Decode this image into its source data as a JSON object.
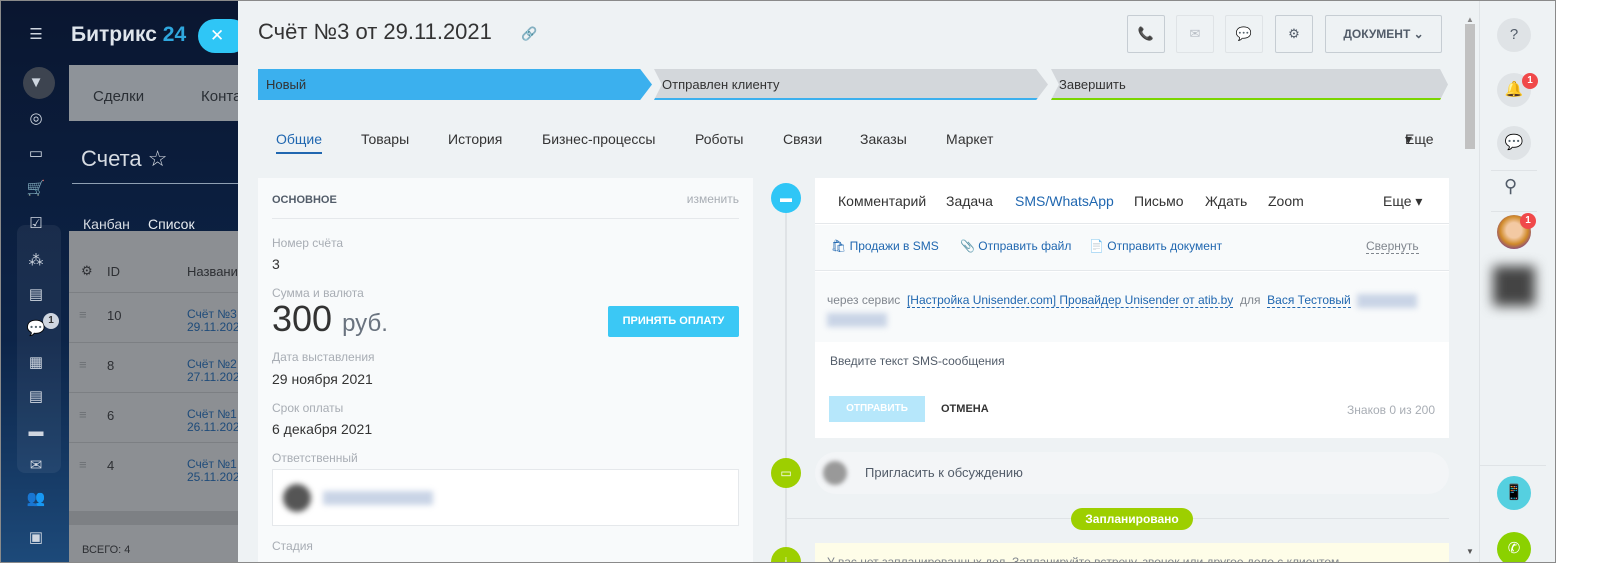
{
  "background": {
    "logo": "Битрикс",
    "logo_accent": "24",
    "crm_tabs": [
      "Сделки",
      "Конта"
    ],
    "page_title": "Счета",
    "views": [
      "Канбан",
      "Список"
    ],
    "grid_headers": [
      "ID",
      "Названи"
    ],
    "rows": [
      {
        "id": "10",
        "name": "Счёт №3",
        "date": "29.11.202"
      },
      {
        "id": "8",
        "name": "Счёт №2",
        "date": "27.11.202"
      },
      {
        "id": "6",
        "name": "Счёт №1",
        "date": "26.11.202"
      },
      {
        "id": "4",
        "name": "Счёт №1",
        "date": "25.11.202"
      }
    ],
    "total": "ВСЕГО: 4",
    "chat_badge": "1"
  },
  "header": {
    "title": "Счёт №3 от 29.11.2021",
    "document_button": "ДОКУМЕНТ"
  },
  "stages": [
    {
      "label": "Новый",
      "color": "#3bb0ee"
    },
    {
      "label": "Отправлен клиенту",
      "color": "#d3d7db"
    },
    {
      "label": "Завершить",
      "color": "#d3d7db"
    }
  ],
  "tabs": [
    "Общие",
    "Товары",
    "История",
    "Бизнес-процессы",
    "Роботы",
    "Связи",
    "Заказы",
    "Маркет"
  ],
  "tabs_more": "Еще",
  "main": {
    "section": "ОСНОВНОЕ",
    "edit": "изменить",
    "number_label": "Номер счёта",
    "number": "3",
    "sum_label": "Сумма и валюта",
    "amount": "300",
    "currency": "руб.",
    "pay_button": "ПРИНЯТЬ ОПЛАТУ",
    "date_label": "Дата выставления",
    "date": "29 ноября 2021",
    "due_label": "Срок оплаты",
    "due": "6 декабря 2021",
    "responsible_label": "Ответственный",
    "stage_label": "Стадия"
  },
  "editor": {
    "tabs": [
      "Комментарий",
      "Задача",
      "SMS/WhatsApp",
      "Письмо",
      "Ждать",
      "Zoom"
    ],
    "more": "Еще",
    "actions": [
      "Продажи в SMS",
      "Отправить файл",
      "Отправить документ"
    ],
    "collapse": "Свернуть",
    "via": "через сервис",
    "provider": "[Настройка Unisender.com] Провайдер Unisender от atib.by",
    "for": "для",
    "recipient": "Вася Тестовый",
    "placeholder": "Введите текст SMS-сообщения",
    "send": "ОТПРАВИТЬ",
    "cancel": "ОТМЕНА",
    "counter_prefix": "Знаков",
    "counter": "0",
    "counter_sep": "из",
    "counter_max": "200"
  },
  "invite": "Пригласить к обсуждению",
  "planned": "Запланировано",
  "planned_empty": "У вас нет запланированных дел. Запланируйте встречу, звонок или другое дело с клиентом.",
  "right": {
    "notif_badge": "1",
    "avatar_badge": "1"
  }
}
